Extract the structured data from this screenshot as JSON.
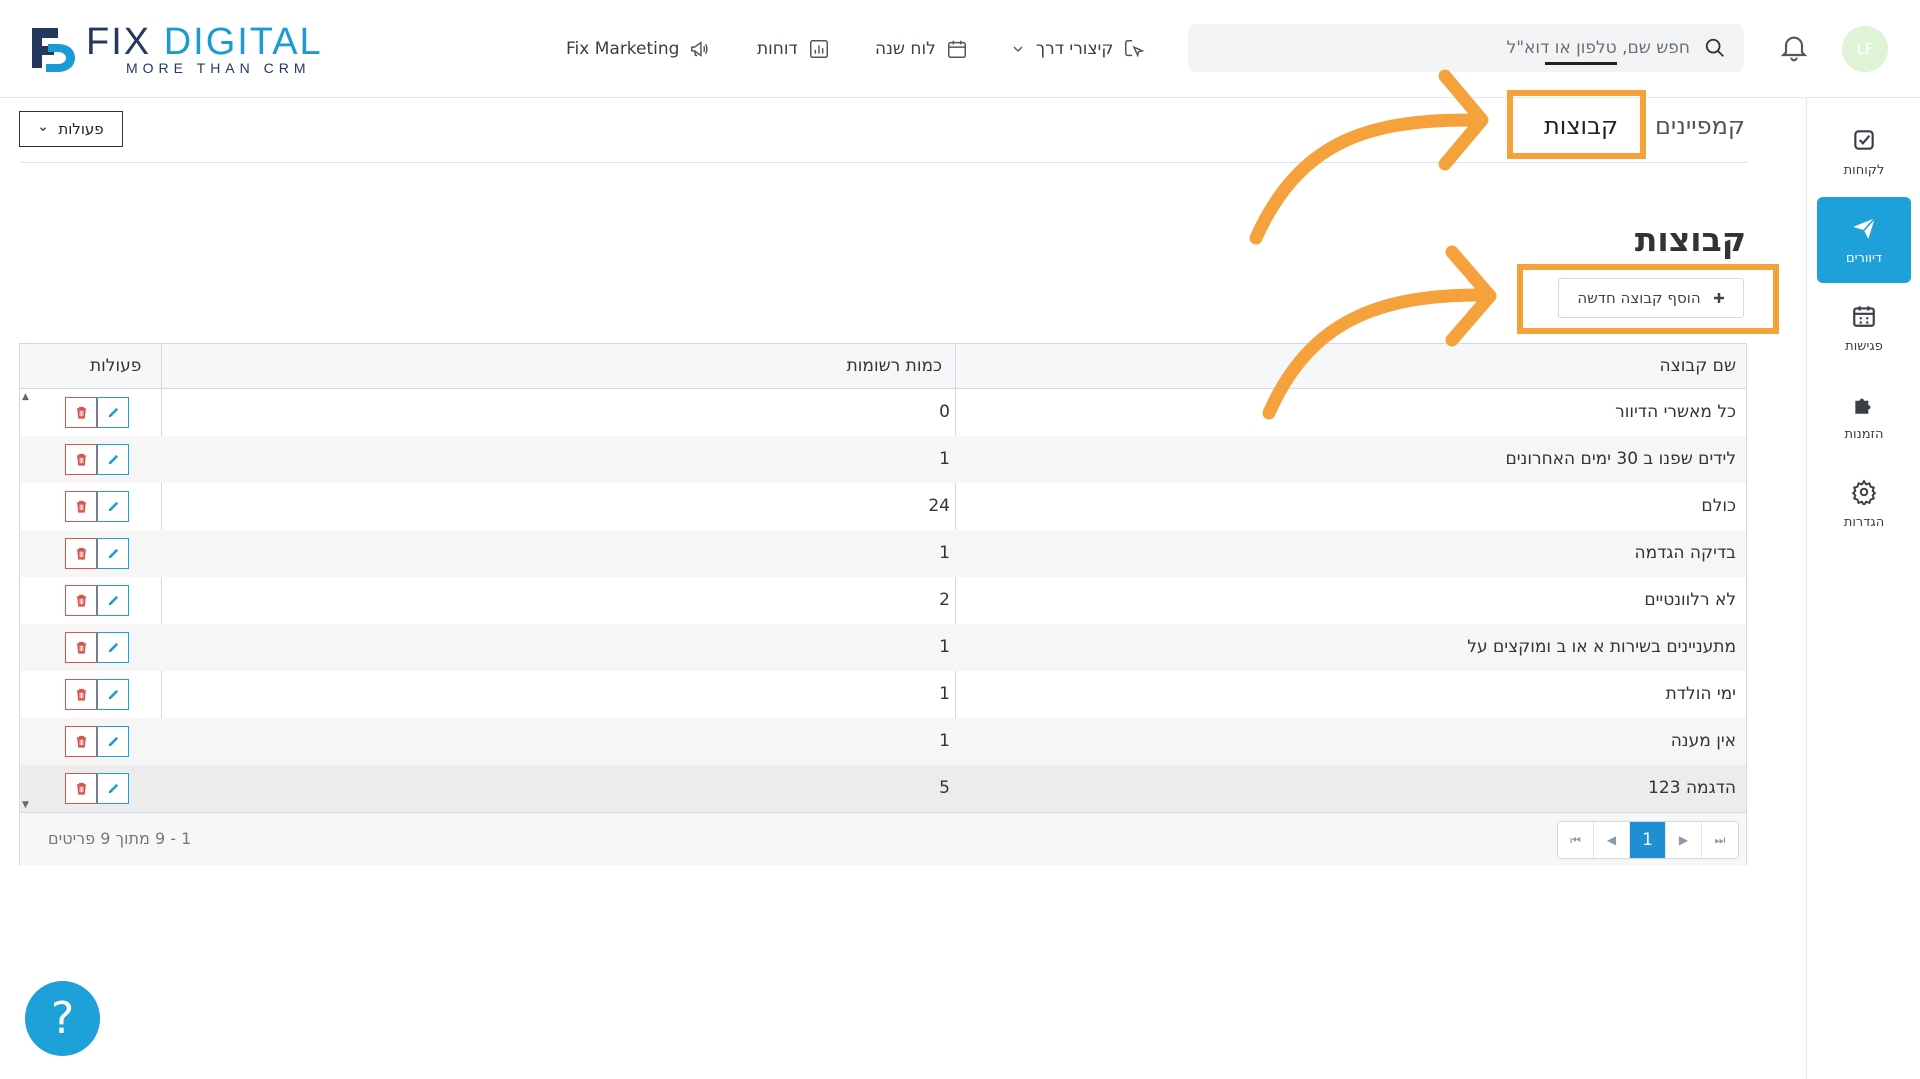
{
  "brand": {
    "name_part1": "FIX",
    "name_part2": "DIGITAL",
    "tagline": "MORE THAN CRM"
  },
  "topnav": [
    {
      "label": "Fix Marketing",
      "icon": "megaphone-icon"
    },
    {
      "label": "דוחות",
      "icon": "bar-chart-icon"
    },
    {
      "label": "לוח שנה",
      "icon": "calendar-icon"
    },
    {
      "label": "קיצורי דרך",
      "icon": "cursor-click-icon"
    }
  ],
  "search": {
    "placeholder": "חפש שם, טלפון או דוא\"ל"
  },
  "user": {
    "initials": "LF"
  },
  "sidebar": [
    {
      "label": "לקוחות",
      "icon": "checkbox-icon"
    },
    {
      "label": "דיוורים",
      "icon": "paper-plane-icon",
      "active": true
    },
    {
      "label": "פגישות",
      "icon": "calendar-grid-icon"
    },
    {
      "label": "הזמנות",
      "icon": "puzzle-icon"
    },
    {
      "label": "הגדרות",
      "icon": "gear-icon"
    }
  ],
  "tabs": [
    {
      "label": "קמפיינים"
    },
    {
      "label": "קבוצות",
      "active": true
    }
  ],
  "actions_dropdown": {
    "label": "פעולות"
  },
  "page": {
    "title": "קבוצות",
    "add_button": "הוסף קבוצה חדשה"
  },
  "table": {
    "columns": [
      "שם קבוצה",
      "כמות רשומות",
      "פעולות"
    ],
    "rows": [
      {
        "name": "כל מאשרי הדיוור",
        "count": "0"
      },
      {
        "name": "לידים שפנו ב 30 ימים האחרונים",
        "count": "1"
      },
      {
        "name": "כולם",
        "count": "24"
      },
      {
        "name": "בדיקה הגדמה",
        "count": "1"
      },
      {
        "name": "לא רלוונטיים",
        "count": "2"
      },
      {
        "name": "מתעניינים בשירות א או ב ומוקצים על",
        "count": "1"
      },
      {
        "name": "ימי הולדת",
        "count": "1"
      },
      {
        "name": "אין מענה",
        "count": "1"
      },
      {
        "name": "הדגמה 123",
        "count": "5"
      }
    ]
  },
  "pager": {
    "info": "1 - 9 מתוך 9 פריטים",
    "current_page": "1"
  },
  "help": {
    "label": "?"
  },
  "colors": {
    "accent": "#1ea1d8",
    "highlight": "#f6a23c",
    "delete": "#d9534f"
  }
}
